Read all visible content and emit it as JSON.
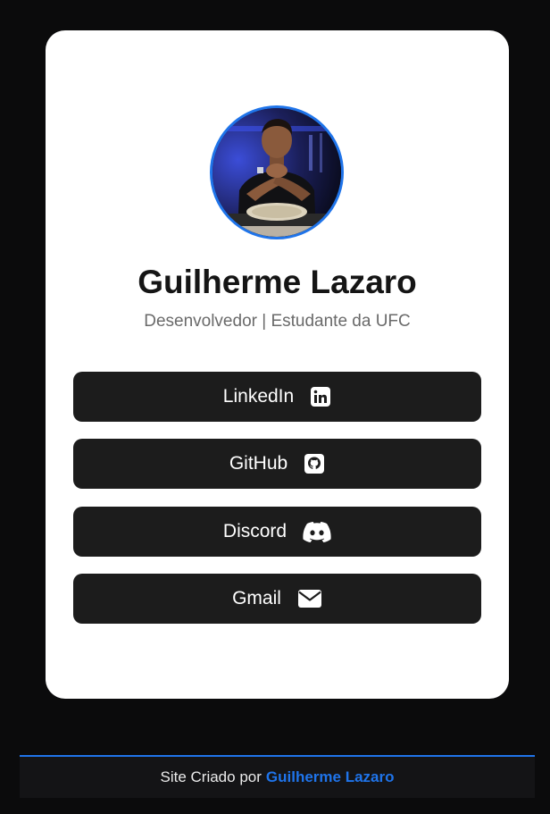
{
  "profile": {
    "name": "Guilherme Lazaro",
    "subtitle": "Desenvolvedor | Estudante da UFC",
    "avatar_alt": "profile-photo"
  },
  "links": [
    {
      "label": "LinkedIn",
      "icon": "linkedin-icon"
    },
    {
      "label": "GitHub",
      "icon": "github-icon"
    },
    {
      "label": "Discord",
      "icon": "discord-icon"
    },
    {
      "label": "Gmail",
      "icon": "mail-icon"
    }
  ],
  "footer": {
    "prefix": "Site Criado por",
    "author": "Guilherme Lazaro"
  },
  "colors": {
    "background": "#0b0b0c",
    "card": "#ffffff",
    "button": "#1c1c1c",
    "accent": "#1f74ea",
    "name": "#151515",
    "subtitle": "#6a6a6a"
  }
}
